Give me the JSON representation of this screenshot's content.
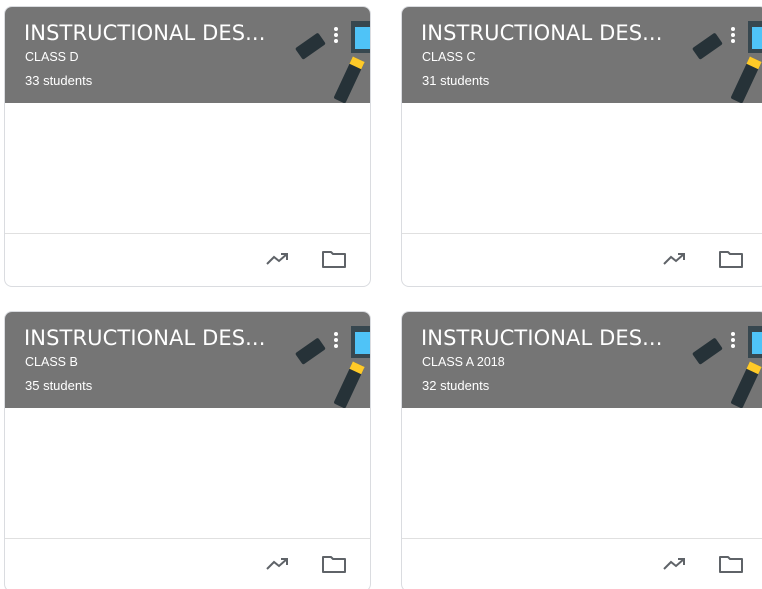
{
  "icons": {
    "menu": "more-vert-icon",
    "trend": "trending-up-icon",
    "folder": "folder-icon"
  },
  "colors": {
    "header_bg": "#757575",
    "header_text": "#ffffff",
    "icon": "#5f6368"
  },
  "classes": [
    {
      "title": "INSTRUCTIONAL DES...",
      "section": "CLASS D",
      "students": "33 students"
    },
    {
      "title": "INSTRUCTIONAL DES...",
      "section": "CLASS C",
      "students": "31 students"
    },
    {
      "title": "INSTRUCTIONAL DES...",
      "section": "CLASS B",
      "students": "35 students"
    },
    {
      "title": "INSTRUCTIONAL DES...",
      "section": "CLASS A 2018",
      "students": "32 students"
    }
  ]
}
